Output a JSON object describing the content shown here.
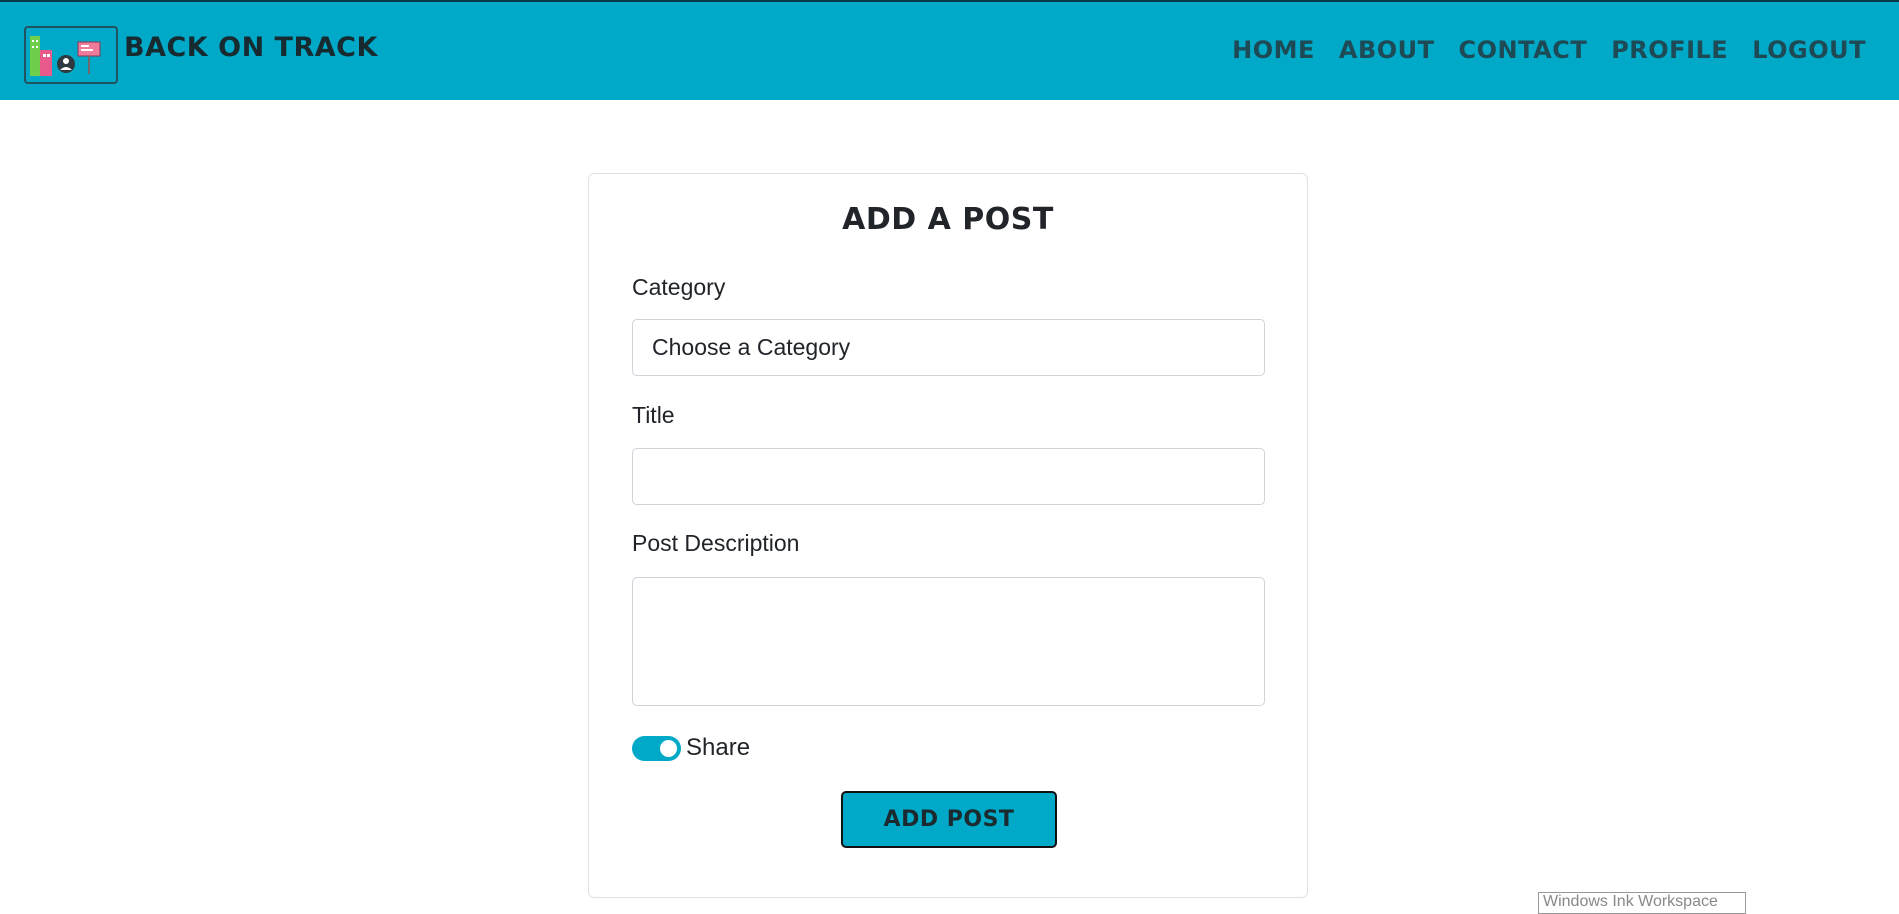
{
  "header": {
    "brand": "BACK ON TRACK",
    "logo_icon": "city-people-billboard-icon",
    "nav": [
      "HOME",
      "ABOUT",
      "CONTACT",
      "PROFILE",
      "LOGOUT"
    ]
  },
  "form": {
    "title": "ADD A POST",
    "category_label": "Category",
    "category_value": "Choose a Category",
    "title_label": "Title",
    "title_value": "",
    "description_label": "Post Description",
    "description_value": "",
    "share_label": "Share",
    "share_on": true,
    "submit_label": "ADD POST"
  },
  "overlay": {
    "ink_workspace": "Windows Ink Workspace"
  },
  "colors": {
    "accent": "#00a9c7",
    "nav_text": "#1e4a56",
    "brand_text": "#162a30"
  }
}
